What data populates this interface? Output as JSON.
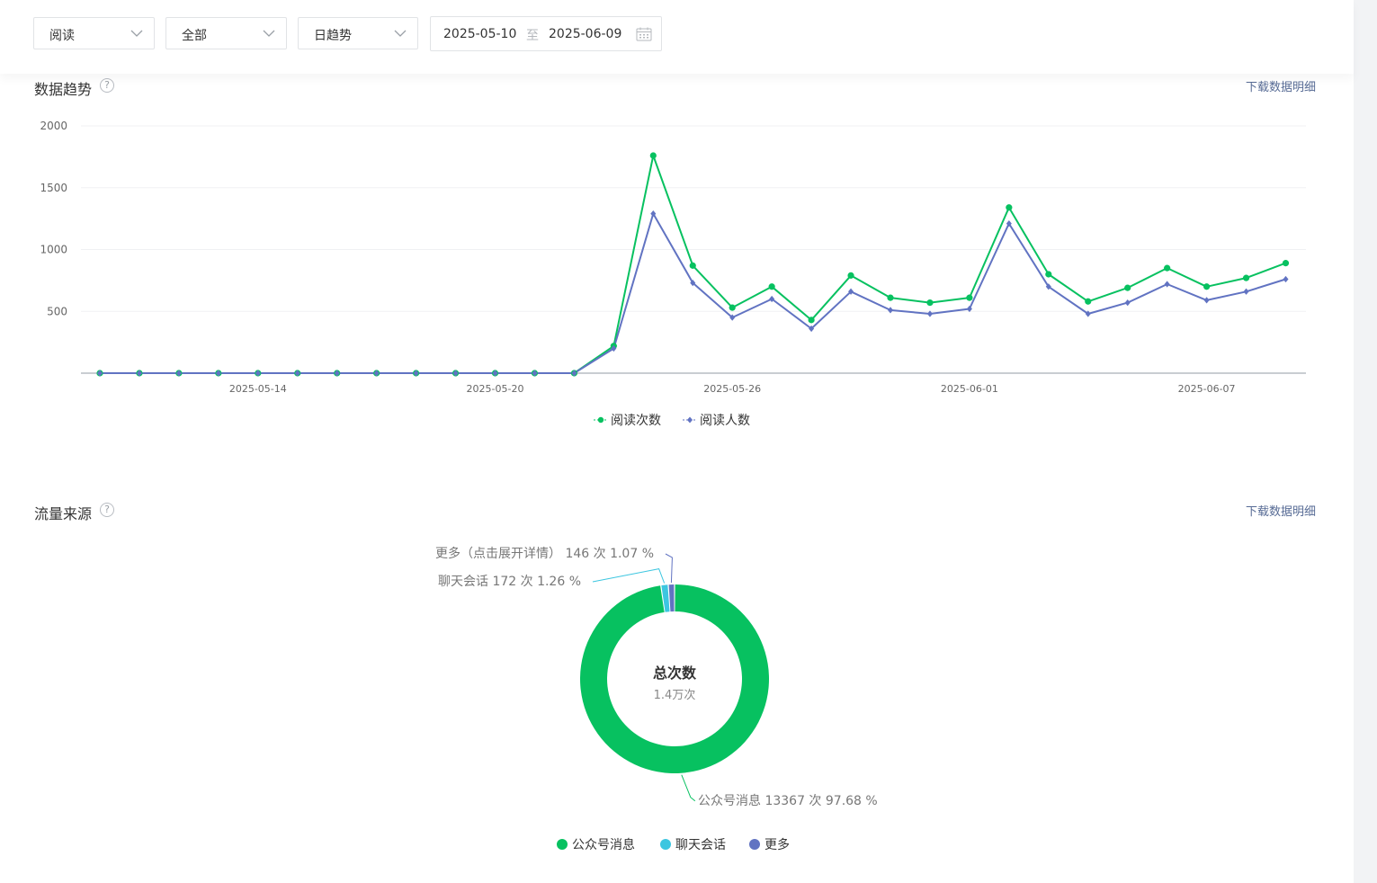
{
  "filters": {
    "metric": "阅读",
    "scope": "全部",
    "granularity": "日趋势",
    "date_start": "2025-05-10",
    "date_separator": "至",
    "date_end": "2025-06-09"
  },
  "trend_section": {
    "title": "数据趋势",
    "help": "?",
    "download": "下载数据明细"
  },
  "traffic_section": {
    "title": "流量来源",
    "help": "?",
    "download": "下载数据明细",
    "center_title": "总次数",
    "center_value": "1.4万次"
  },
  "colors": {
    "green": "#07c160",
    "purple": "#6173c2",
    "cyan": "#3cc6e0",
    "link": "#576b95"
  },
  "icons": [
    "chevron-down-icon",
    "calendar-icon",
    "help-icon",
    "legend-dot-icon"
  ],
  "chart_data": [
    {
      "type": "line",
      "x": [
        "2025-05-10",
        "2025-05-11",
        "2025-05-12",
        "2025-05-13",
        "2025-05-14",
        "2025-05-15",
        "2025-05-16",
        "2025-05-17",
        "2025-05-18",
        "2025-05-19",
        "2025-05-20",
        "2025-05-21",
        "2025-05-22",
        "2025-05-23",
        "2025-05-24",
        "2025-05-25",
        "2025-05-26",
        "2025-05-27",
        "2025-05-28",
        "2025-05-29",
        "2025-05-30",
        "2025-05-31",
        "2025-06-01",
        "2025-06-02",
        "2025-06-03",
        "2025-06-04",
        "2025-06-05",
        "2025-06-06",
        "2025-06-07",
        "2025-06-08",
        "2025-06-09"
      ],
      "x_tick_labels": [
        "2025-05-14",
        "2025-05-20",
        "2025-05-26",
        "2025-06-01",
        "2025-06-07"
      ],
      "yticks": [
        "500",
        "1000",
        "1500",
        "2000"
      ],
      "ylim": [
        0,
        2000
      ],
      "series": [
        {
          "name": "阅读次数",
          "color": "#07c160",
          "marker": "circle",
          "values": [
            0,
            0,
            0,
            0,
            0,
            0,
            0,
            0,
            0,
            0,
            0,
            0,
            0,
            220,
            1760,
            870,
            530,
            700,
            430,
            790,
            610,
            570,
            610,
            1340,
            800,
            580,
            690,
            850,
            700,
            770,
            890
          ]
        },
        {
          "name": "阅读人数",
          "color": "#6173c2",
          "marker": "diamond",
          "values": [
            0,
            0,
            0,
            0,
            0,
            0,
            0,
            0,
            0,
            0,
            0,
            0,
            0,
            200,
            1290,
            730,
            450,
            600,
            360,
            660,
            510,
            480,
            520,
            1210,
            700,
            480,
            570,
            720,
            590,
            660,
            760
          ]
        }
      ],
      "legend_position": "bottom-center",
      "grid": true
    },
    {
      "type": "pie",
      "title": "总次数",
      "slices": [
        {
          "name": "公众号消息",
          "value": 13367,
          "percent": 97.68,
          "label": "公众号消息 13367 次 97.68 %",
          "color": "#07c160"
        },
        {
          "name": "聊天会话",
          "value": 172,
          "percent": 1.26,
          "label": "聊天会话 172 次 1.26 %",
          "color": "#3cc6e0"
        },
        {
          "name": "更多",
          "value": 146,
          "percent": 1.07,
          "label": "更多（点击展开详情） 146 次 1.07 %",
          "color": "#6173c2"
        }
      ],
      "legend_position": "bottom-center"
    }
  ]
}
